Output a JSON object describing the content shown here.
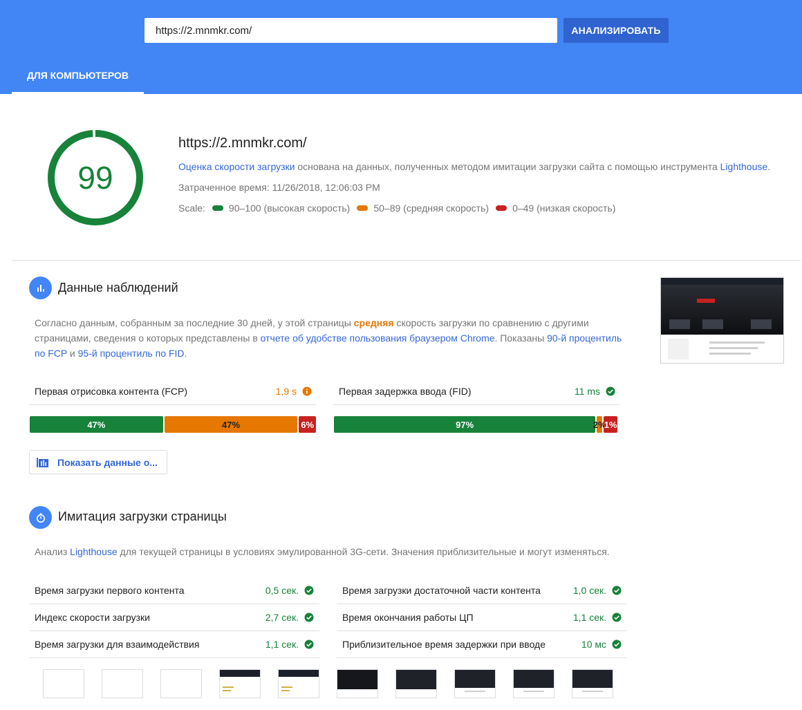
{
  "header": {
    "url_value": "https://2.mnmkr.com/",
    "analyze_label": "АНАЛИЗИРОВАТЬ",
    "tab_label": "ДЛЯ КОМПЬЮТЕРОВ"
  },
  "summary": {
    "score": "99",
    "score_fraction": 0.99,
    "url": "https://2.mnmkr.com/",
    "desc_link1": "Оценка скорости загрузки",
    "desc_mid": " основана на данных, полученных методом имитации загрузки сайта с помощью инструмента ",
    "desc_link2": "Lighthouse",
    "desc_end": ".",
    "time": "Затраченное время: 11/26/2018, 12:06:03 PM",
    "scale_label": "Scale:",
    "scale_good": "90–100 (высокая скорость)",
    "scale_avg": "50–89 (средняя скорость)",
    "scale_poor": "0–49 (низкая скорость)"
  },
  "field": {
    "title": "Данные наблюдений",
    "desc_p1": "Согласно данным, собранным за последние 30 дней, у этой страницы ",
    "desc_bold": "средняя",
    "desc_p2": " скорость загрузки по сравнению с другими страницами, сведения о которых представлены в ",
    "desc_link1": "отчете об удобстве пользования браузером Chrome",
    "desc_p3": ". Показаны ",
    "desc_link2": "90-й процентиль по FCP",
    "desc_p4": " и ",
    "desc_link3": "95-й процентиль по FID",
    "desc_p5": ".",
    "fcp": {
      "label": "Первая отрисовка контента (FCP)",
      "value": "1,9 s",
      "dist": {
        "fast": 47,
        "avg": 47,
        "slow": 6
      },
      "fast_label": "47%",
      "avg_label": "47%",
      "slow_label": "6%"
    },
    "fid": {
      "label": "Первая задержка ввода (FID)",
      "value": "11 ms",
      "dist": {
        "fast": 97,
        "avg": 2,
        "slow": 1
      },
      "fast_label": "97%",
      "avg_label": "2%",
      "slow_label": "1%"
    },
    "origin_button": "Показать данные о..."
  },
  "lab": {
    "title": "Имитация загрузки страницы",
    "desc_p1": "Анализ ",
    "desc_link": "Lighthouse",
    "desc_p2": " для текущей страницы в условиях эмулированной 3G-сети. Значения приблизительные и могут изменяться.",
    "metrics_left": [
      {
        "label": "Время загрузки первого контента",
        "value": "0,5 сек."
      },
      {
        "label": "Индекс скорости загрузки",
        "value": "2,7 сек."
      },
      {
        "label": "Время загрузки для взаимодействия",
        "value": "1,1 сек."
      }
    ],
    "metrics_right": [
      {
        "label": "Время загрузки достаточной части контента",
        "value": "1,0 сек."
      },
      {
        "label": "Время окончания работы ЦП",
        "value": "1,1 сек."
      },
      {
        "label": "Приблизительное время задержки при вводе",
        "value": "10 мс"
      }
    ]
  },
  "colors": {
    "header_blue": "#4285f4",
    "good": "#178239",
    "average": "#e67700",
    "poor": "#c7221f",
    "link": "#3367d6"
  },
  "icons": [
    "bar-chart-icon",
    "stopwatch-icon",
    "info-icon",
    "check-circle-icon",
    "origin-chart-icon"
  ]
}
